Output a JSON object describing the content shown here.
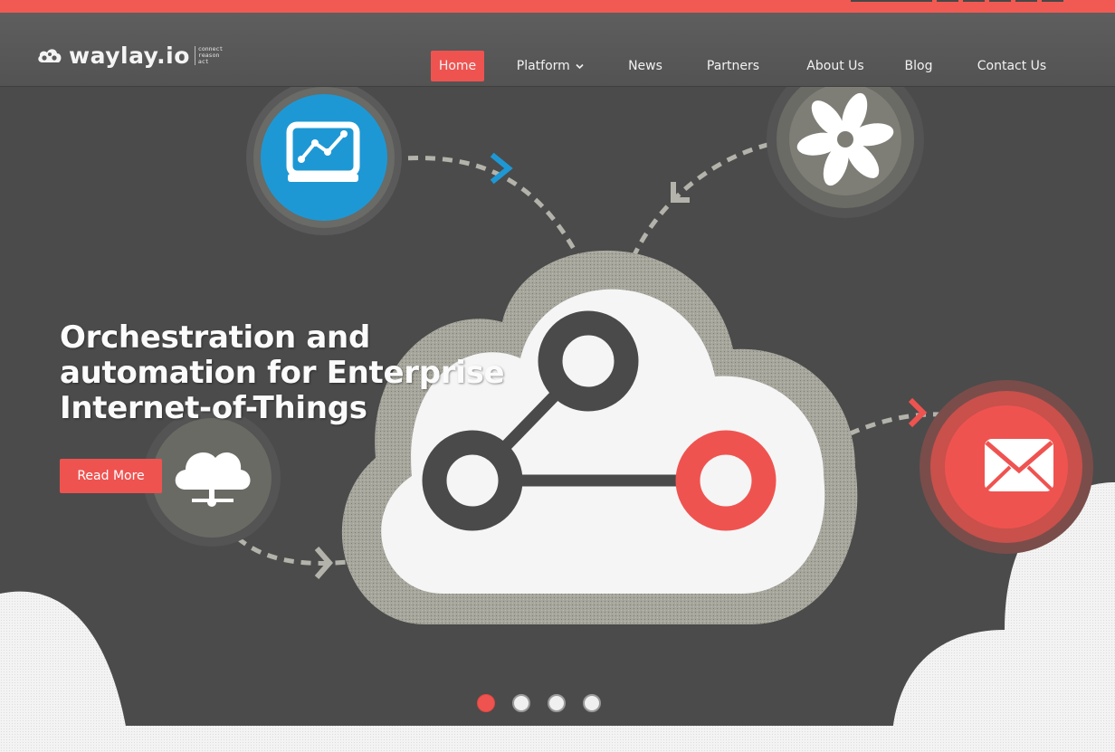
{
  "brand": {
    "name": "waylay.io",
    "tagline": [
      "connect",
      "reason",
      "act"
    ]
  },
  "nav": {
    "items": [
      {
        "label": "Home",
        "active": true
      },
      {
        "label": "Platform",
        "has_dropdown": true
      },
      {
        "label": "News"
      },
      {
        "label": "Partners"
      },
      {
        "label": "About Us"
      },
      {
        "label": "Blog"
      },
      {
        "label": "Contact Us"
      }
    ]
  },
  "hero": {
    "headline_lines": [
      "Orchestration and",
      "automation for Enterprise",
      "Internet-of-Things"
    ],
    "cta_label": "Read More"
  },
  "carousel": {
    "slide_count": 4,
    "active_index": 0
  },
  "icons": {
    "dropdown": "chevron-down-icon",
    "analytics": "chart-monitor-icon",
    "integration": "flower-icon",
    "network": "cloud-network-icon",
    "mail": "envelope-icon",
    "central": "cloud-graph-icon"
  },
  "colors": {
    "accent": "#ef5350",
    "background": "#4b4b4b",
    "navbar": "#595959",
    "blue": "#1e98d4",
    "muted_ring": "#8e8e84"
  }
}
